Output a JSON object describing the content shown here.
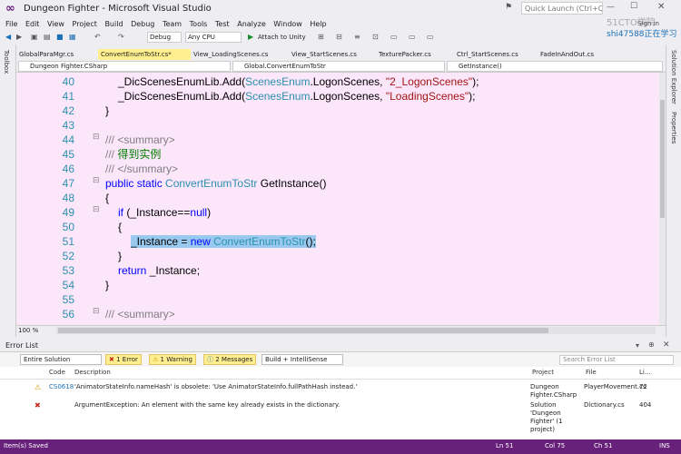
{
  "window": {
    "title": "Dungeon Fighter - Microsoft Visual Studio",
    "quick_launch": "Quick Launch (Ctrl+Q)",
    "sign_in": "Sign in"
  },
  "watermark": {
    "line1": "51CTO学院",
    "line2": "shi47588正在学习"
  },
  "menu": [
    "File",
    "Edit",
    "View",
    "Project",
    "Build",
    "Debug",
    "Team",
    "Tools",
    "Test",
    "Analyze",
    "Window",
    "Help"
  ],
  "toolbar": {
    "config": "Debug",
    "platform": "Any CPU",
    "attach": "Attach to Unity"
  },
  "side": {
    "left": "Toolbox",
    "right1": "Solution Explorer",
    "right2": "Properties"
  },
  "tabs": [
    "GlobalParaMgr.cs",
    "ConvertEnumToStr.cs*",
    "View_LoadingScenes.cs",
    "View_StartScenes.cs",
    "TexturePacker.cs",
    "Ctrl_StartScenes.cs",
    "FadeInAndOut.cs"
  ],
  "nav": {
    "project": "Dungeon Fighter.CSharp",
    "class": "Global.ConvertEnumToStr",
    "member": "GetInstance()"
  },
  "code": {
    "lines": [
      "40",
      "41",
      "42",
      "43",
      "44",
      "45",
      "46",
      "47",
      "48",
      "49",
      "50",
      "51",
      "52",
      "53",
      "54",
      "55",
      "56"
    ],
    "l40": [
      "_DicScenesEnumLib.Add(",
      "ScenesEnum",
      ".LogonScenes, ",
      "\"2_LogonScenes\"",
      ");"
    ],
    "l41": [
      "_DicScenesEnumLib.Add(",
      "ScenesEnum",
      ".LogonScenes, ",
      "\"LoadingScenes\"",
      ");"
    ],
    "l42": "}",
    "l44": "/// <summary>",
    "l45": [
      "/// ",
      "得到实例"
    ],
    "l46": "/// </summary>",
    "l47": [
      "public",
      " static ",
      "ConvertEnumToStr",
      " GetInstance()"
    ],
    "l48": "{",
    "l49": [
      "if",
      " (_Instance==",
      "null",
      ")"
    ],
    "l50": "{",
    "l51": [
      "_Instance = ",
      "new",
      " ",
      "ConvertEnumToStr",
      "();"
    ],
    "l52": "}",
    "l53": [
      "return",
      " _Instance;"
    ],
    "l54": "}",
    "l56": "/// <summary>"
  },
  "zoom": "100 %",
  "error_list": {
    "title": "Error List",
    "scope": "Entire Solution",
    "errors": "1 Error",
    "warnings": "1 Warning",
    "messages": "2 Messages",
    "build": "Build + IntelliSense",
    "search": "Search Error List",
    "headers": {
      "code": "Code",
      "description": "Description",
      "project": "Project",
      "file": "File",
      "line": "Li..."
    },
    "rows": [
      {
        "code": "CS0618",
        "description": "'AnimatorStateInfo.nameHash' is obsolete: 'Use AnimatorStateInfo.fullPathHash instead.'",
        "project": "Dungeon Fighter.CSharp",
        "file": "PlayerMovement.cs",
        "line": "72"
      },
      {
        "code": "",
        "description": "ArgumentException: An element with the same key already exists in the dictionary.",
        "project": "Solution 'Dungeon Fighter' (1 project)",
        "file": "Dictionary.cs",
        "line": "404"
      }
    ]
  },
  "status": {
    "left": "Item(s) Saved",
    "ln": "Ln 51",
    "col": "Col 75",
    "ch": "Ch 51",
    "mode": "INS"
  },
  "colors": {
    "accent": "#68217a",
    "editor_bg": "#fce6fa",
    "selection": "#99c9ef"
  }
}
